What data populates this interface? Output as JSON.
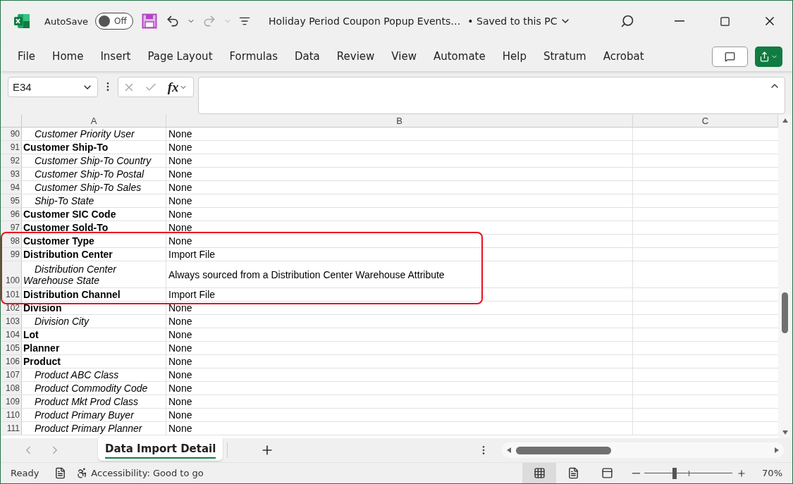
{
  "window": {
    "title": "Holiday Period Coupon Popup Events…",
    "save_status": "• Saved to this PC"
  },
  "autosave": {
    "label": "AutoSave",
    "state_text": "Off",
    "on": false
  },
  "ribbon_tabs": [
    "File",
    "Home",
    "Insert",
    "Page Layout",
    "Formulas",
    "Data",
    "Review",
    "View",
    "Automate",
    "Help",
    "Stratum",
    "Acrobat"
  ],
  "formula_bar": {
    "name_box": "E34",
    "fx_label": "fx"
  },
  "sheet": {
    "columns": [
      "A",
      "B",
      "C"
    ],
    "rows": [
      {
        "num": "90",
        "kind": "field",
        "label": "Customer Priority User",
        "value": "None",
        "highlighted": false,
        "wrapped": false
      },
      {
        "num": "91",
        "kind": "group",
        "label": "Customer Ship-To",
        "value": "None",
        "highlighted": false,
        "wrapped": false
      },
      {
        "num": "92",
        "kind": "field",
        "label": "Customer Ship-To Country",
        "value": "None",
        "highlighted": false,
        "wrapped": false
      },
      {
        "num": "93",
        "kind": "field",
        "label": "Customer Ship-To Postal",
        "value": "None",
        "highlighted": false,
        "wrapped": false
      },
      {
        "num": "94",
        "kind": "field",
        "label": "Customer Ship-To Sales",
        "value": "None",
        "highlighted": false,
        "wrapped": false
      },
      {
        "num": "95",
        "kind": "field",
        "label": "Ship-To State",
        "value": "None",
        "highlighted": false,
        "wrapped": false
      },
      {
        "num": "96",
        "kind": "group",
        "label": "Customer SIC Code",
        "value": "None",
        "highlighted": false,
        "wrapped": false
      },
      {
        "num": "97",
        "kind": "group",
        "label": "Customer Sold-To",
        "value": "None",
        "highlighted": false,
        "wrapped": false
      },
      {
        "num": "98",
        "kind": "group",
        "label": "Customer Type",
        "value": "None",
        "highlighted": true,
        "wrapped": false
      },
      {
        "num": "99",
        "kind": "group",
        "label": "Distribution Center",
        "value": "Import File",
        "highlighted": true,
        "wrapped": false
      },
      {
        "num": "100",
        "kind": "field",
        "label": "Distribution Center Warehouse State",
        "value": "Always sourced from a Distribution Center Warehouse Attribute",
        "highlighted": true,
        "wrapped": true
      },
      {
        "num": "101",
        "kind": "group",
        "label": "Distribution Channel",
        "value": "Import File",
        "highlighted": true,
        "wrapped": false
      },
      {
        "num": "102",
        "kind": "group",
        "label": "Division",
        "value": "None",
        "highlighted": false,
        "wrapped": false
      },
      {
        "num": "103",
        "kind": "field",
        "label": "Division City",
        "value": "None",
        "highlighted": false,
        "wrapped": false
      },
      {
        "num": "104",
        "kind": "group",
        "label": "Lot",
        "value": "None",
        "highlighted": false,
        "wrapped": false
      },
      {
        "num": "105",
        "kind": "group",
        "label": "Planner",
        "value": "None",
        "highlighted": false,
        "wrapped": false
      },
      {
        "num": "106",
        "kind": "group",
        "label": "Product",
        "value": "None",
        "highlighted": false,
        "wrapped": false
      },
      {
        "num": "107",
        "kind": "field",
        "label": "Product ABC Class",
        "value": "None",
        "highlighted": false,
        "wrapped": false
      },
      {
        "num": "108",
        "kind": "field",
        "label": "Product Commodity Code",
        "value": "None",
        "highlighted": false,
        "wrapped": false
      },
      {
        "num": "109",
        "kind": "field",
        "label": "Product Mkt Prod Class",
        "value": "None",
        "highlighted": false,
        "wrapped": false
      },
      {
        "num": "110",
        "kind": "field",
        "label": "Product Primary Buyer",
        "value": "None",
        "highlighted": false,
        "wrapped": false
      },
      {
        "num": "111",
        "kind": "field",
        "label": "Product Primary Planner",
        "value": "None",
        "highlighted": false,
        "wrapped": false
      }
    ]
  },
  "sheet_tabs": [
    {
      "label": "Data Import Detail",
      "selected": true
    }
  ],
  "status_bar": {
    "status": "Ready",
    "accessibility": "Accessibility: Good to go",
    "views": [
      {
        "kind": "normal",
        "selected": true
      },
      {
        "kind": "page_layout",
        "selected": false
      },
      {
        "kind": "page_break",
        "selected": false
      }
    ],
    "zoom": {
      "level": 0.34,
      "reading": "70%"
    }
  }
}
